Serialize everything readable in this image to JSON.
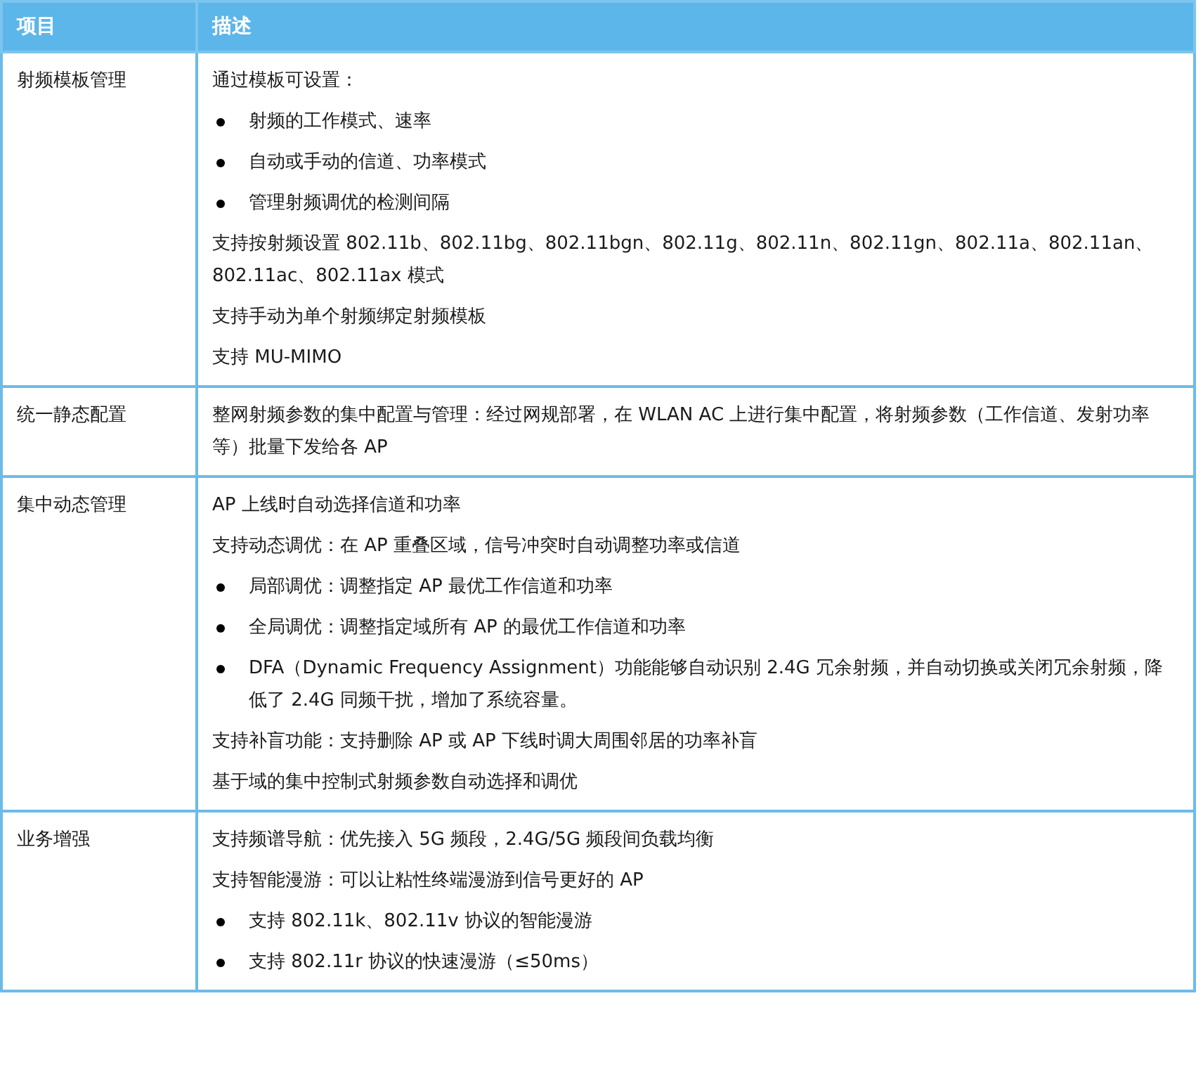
{
  "table": {
    "columns": [
      "项目",
      "描述"
    ],
    "rows": [
      {
        "item": "射频模板管理",
        "description": [
          {
            "kind": "para",
            "text": "通过模板可设置："
          },
          {
            "kind": "bullet",
            "text": "射频的工作模式、速率"
          },
          {
            "kind": "bullet",
            "text": "自动或手动的信道、功率模式"
          },
          {
            "kind": "bullet",
            "text": "管理射频调优的检测间隔"
          },
          {
            "kind": "para",
            "text": "支持按射频设置 802.11b、802.11bg、802.11bgn、802.11g、802.11n、802.11gn、802.11a、802.11an、802.11ac、802.11ax 模式"
          },
          {
            "kind": "para",
            "text": "支持手动为单个射频绑定射频模板"
          },
          {
            "kind": "para",
            "text": "支持 MU-MIMO"
          }
        ]
      },
      {
        "item": "统一静态配置",
        "description": [
          {
            "kind": "para",
            "text": "整网射频参数的集中配置与管理：经过网规部署，在 WLAN AC 上进行集中配置，将射频参数（工作信道、发射功率等）批量下发给各 AP"
          }
        ]
      },
      {
        "item": "集中动态管理",
        "description": [
          {
            "kind": "para",
            "text": "AP 上线时自动选择信道和功率"
          },
          {
            "kind": "para",
            "text": "支持动态调优：在 AP 重叠区域，信号冲突时自动调整功率或信道"
          },
          {
            "kind": "bullet",
            "text": "局部调优：调整指定 AP 最优工作信道和功率"
          },
          {
            "kind": "bullet",
            "text": "全局调优：调整指定域所有 AP 的最优工作信道和功率"
          },
          {
            "kind": "bullet",
            "text": "DFA（Dynamic Frequency Assignment）功能能够自动识别 2.4G 冗余射频，并自动切换或关闭冗余射频，降低了 2.4G 同频干扰，增加了系统容量。"
          },
          {
            "kind": "para",
            "text": "支持补盲功能：支持删除 AP 或 AP 下线时调大周围邻居的功率补盲"
          },
          {
            "kind": "para",
            "text": "基于域的集中控制式射频参数自动选择和调优"
          }
        ]
      },
      {
        "item": "业务增强",
        "description": [
          {
            "kind": "para",
            "text": "支持频谱导航：优先接入 5G 频段，2.4G/5G 频段间负载均衡"
          },
          {
            "kind": "para",
            "text": "支持智能漫游：可以让粘性终端漫游到信号更好的 AP"
          },
          {
            "kind": "bullet",
            "text": "支持 802.11k、802.11v 协议的智能漫游"
          },
          {
            "kind": "bullet",
            "text": "支持 802.11r 协议的快速漫游（≤50ms）"
          }
        ]
      }
    ]
  }
}
